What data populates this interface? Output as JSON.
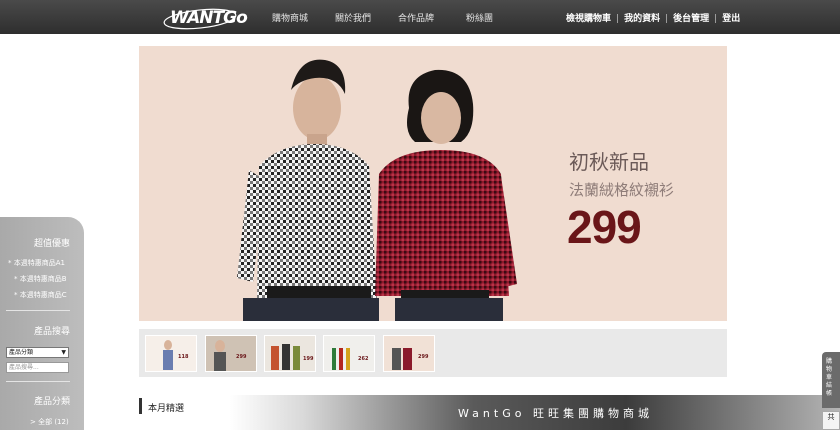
{
  "header": {
    "logo_text": "WANTGo",
    "nav": [
      "購物商城",
      "關於我們",
      "合作品牌",
      "粉絲團"
    ],
    "user_links": [
      "檢視購物車",
      "我的資料",
      "後台管理",
      "登出"
    ]
  },
  "hero": {
    "title": "初秋新品",
    "subtitle": "法蘭絨格紋襯衫",
    "price": "299"
  },
  "thumbnails": [
    {
      "price": "118"
    },
    {
      "price": "299"
    },
    {
      "price": "199"
    },
    {
      "price": "262"
    },
    {
      "price": "299"
    }
  ],
  "sidebar": {
    "promo_heading": "超值優惠",
    "promo_links": [
      "* 本週特惠商品A1",
      "* 本週特惠商品B",
      "* 本週特惠商品C"
    ],
    "search_heading": "產品搜尋",
    "search_select_value": "產品分類",
    "search_placeholder": "產品搜尋...",
    "category_heading": "產品分類",
    "category_all": "> 全部 (12)"
  },
  "main": {
    "section_title": "本月精選",
    "brand_slogan": "WantGo 旺旺集團購物商城"
  },
  "cart_tab": {
    "label": "購物車結帳",
    "count": "共"
  },
  "colors": {
    "topbar": "#2e2e2e",
    "hero_bg": "#f0dcd0",
    "price": "#6a1619",
    "sidebar": "#b0b0b0"
  }
}
